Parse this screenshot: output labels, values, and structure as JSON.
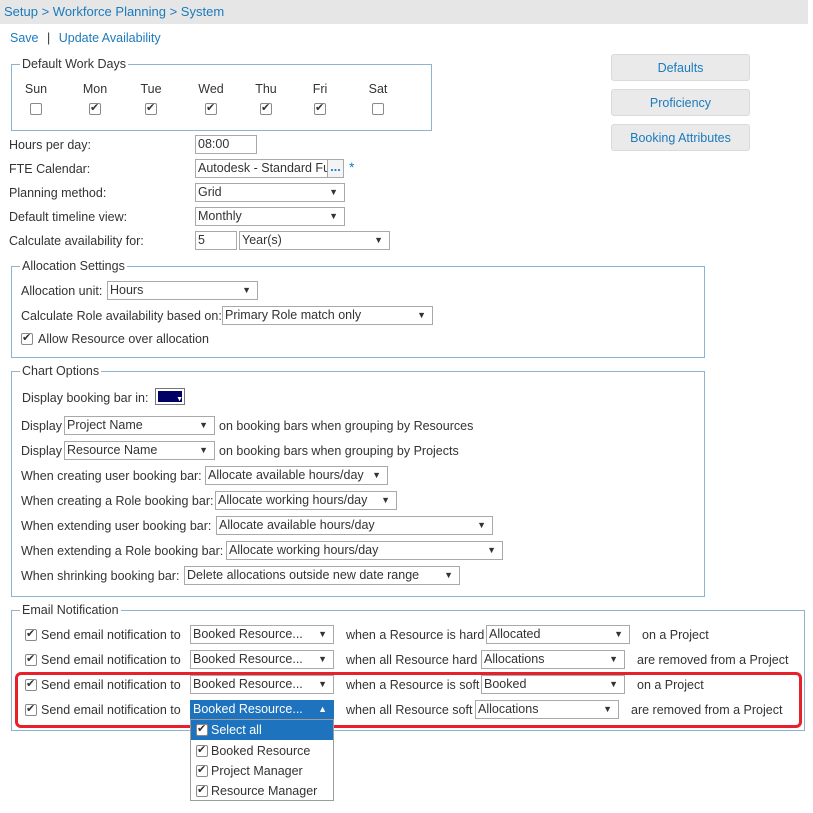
{
  "breadcrumb": "Setup > Workforce Planning > System",
  "actions": {
    "save": "Save",
    "separator": "|",
    "update": "Update Availability"
  },
  "work_days": {
    "legend": "Default Work Days",
    "days": [
      {
        "label": "Sun",
        "checked": false
      },
      {
        "label": "Mon",
        "checked": true
      },
      {
        "label": "Tue",
        "checked": true
      },
      {
        "label": "Wed",
        "checked": true
      },
      {
        "label": "Thu",
        "checked": true
      },
      {
        "label": "Fri",
        "checked": true
      },
      {
        "label": "Sat",
        "checked": false
      }
    ]
  },
  "side_buttons": {
    "defaults": "Defaults",
    "proficiency": "Proficiency",
    "booking_attributes": "Booking Attributes"
  },
  "general": {
    "hours_label": "Hours per day:",
    "hours_value": "08:00",
    "fte_label": "FTE Calendar:",
    "fte_value": "Autodesk - Standard Fu",
    "fte_browse": "...",
    "required": "*",
    "planning_label": "Planning method:",
    "planning_value": "Grid",
    "timeline_label": "Default timeline view:",
    "timeline_value": "Monthly",
    "calc_label": "Calculate availability for:",
    "calc_number": "5",
    "calc_unit": "Year(s)"
  },
  "allocation": {
    "legend": "Allocation Settings",
    "unit_label": "Allocation unit:",
    "unit_value": "Hours",
    "role_label": "Calculate Role availability based on:",
    "role_value": "Primary Role match only",
    "over_alloc_label": "Allow Resource over allocation",
    "over_alloc_checked": true
  },
  "chart_options": {
    "legend": "Chart Options",
    "color_label": "Display booking bar in:",
    "color_value": "#000066",
    "display1_prefix": "Display",
    "display1_value": "Project Name",
    "display1_suffix": "on booking bars when grouping by Resources",
    "display2_prefix": "Display",
    "display2_value": "Resource Name",
    "display2_suffix": "on booking bars when grouping by Projects",
    "create_user_label": "When creating user booking bar:",
    "create_user_value": "Allocate available hours/day",
    "create_role_label": "When creating a Role booking bar:",
    "create_role_value": "Allocate working hours/day",
    "extend_user_label": "When extending user booking bar:",
    "extend_user_value": "Allocate available hours/day",
    "extend_role_label": "When extending a Role booking bar:",
    "extend_role_value": "Allocate working hours/day",
    "shrink_label": "When shrinking booking bar:",
    "shrink_value": "Delete allocations outside new date range"
  },
  "email": {
    "legend": "Email Notification",
    "rows": [
      {
        "checked": true,
        "prefix": "Send email notification to",
        "recipient": "Booked Resource...",
        "condition": "when a Resource is hard",
        "status": "Allocated",
        "suffix": "on a Project"
      },
      {
        "checked": true,
        "prefix": "Send email notification to",
        "recipient": "Booked Resource...",
        "condition": "when all Resource hard",
        "status": "Allocations",
        "suffix": "are removed from a Project"
      },
      {
        "checked": true,
        "prefix": "Send email notification to",
        "recipient": "Booked Resource...",
        "condition": "when a Resource is soft",
        "status": "Booked",
        "suffix": "on a Project"
      },
      {
        "checked": true,
        "prefix": "Send email notification to",
        "recipient": "Booked Resource...",
        "condition": "when all Resource soft",
        "status": "Allocations",
        "suffix": "are removed from a Project"
      }
    ],
    "dropdown_options": [
      {
        "label": "Select all",
        "checked": true
      },
      {
        "label": "Booked Resource",
        "checked": true
      },
      {
        "label": "Project Manager",
        "checked": true
      },
      {
        "label": "Resource Manager",
        "checked": true
      }
    ]
  },
  "colors": {
    "link": "#1b7bbd",
    "selected": "#1e73be",
    "highlight": "#e8202a",
    "fieldset_border": "#8fb3cf"
  }
}
